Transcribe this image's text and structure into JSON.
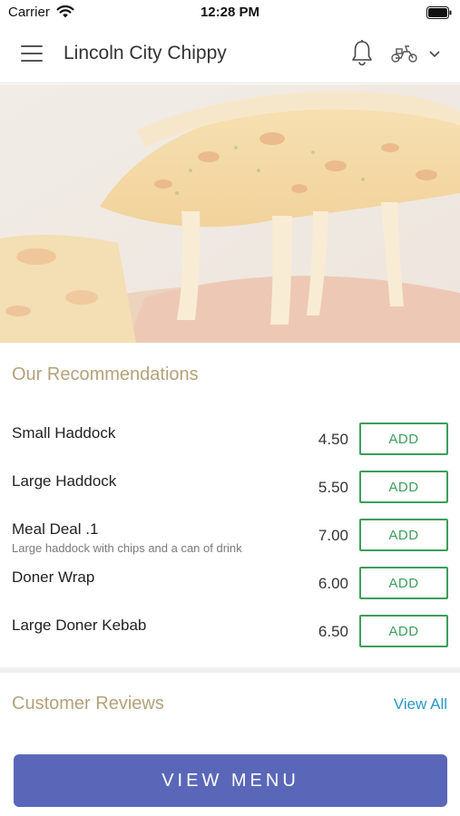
{
  "status_bar": {
    "carrier": "Carrier",
    "time": "12:28 PM"
  },
  "header": {
    "title": "Lincoln City Chippy",
    "icons": [
      "menu-icon",
      "bell-icon",
      "scooter-icon",
      "chevron-down-icon"
    ]
  },
  "hero": {
    "image": "cheese pizza slice with stretched melted cheese"
  },
  "recommendations": {
    "title": "Our Recommendations",
    "items": [
      {
        "name": "Small Haddock",
        "description": "",
        "price": "4.50",
        "add_label": "ADD"
      },
      {
        "name": "Large Haddock",
        "description": "",
        "price": "5.50",
        "add_label": "ADD"
      },
      {
        "name": "Meal Deal .1",
        "description": "Large haddock with chips and a can of drink",
        "price": "7.00",
        "add_label": "ADD"
      },
      {
        "name": "Doner Wrap",
        "description": "",
        "price": "6.00",
        "add_label": "ADD"
      },
      {
        "name": "Large Doner Kebab",
        "description": "",
        "price": "6.50",
        "add_label": "ADD"
      }
    ]
  },
  "reviews": {
    "title": "Customer Reviews",
    "view_all_label": "View All"
  },
  "footer": {
    "view_menu_label": "VIEW MENU"
  },
  "colors": {
    "section_title": "#b3a27a",
    "add_button": "#3b9e5c",
    "link": "#2a97c9",
    "primary_button": "#5a67b8"
  }
}
